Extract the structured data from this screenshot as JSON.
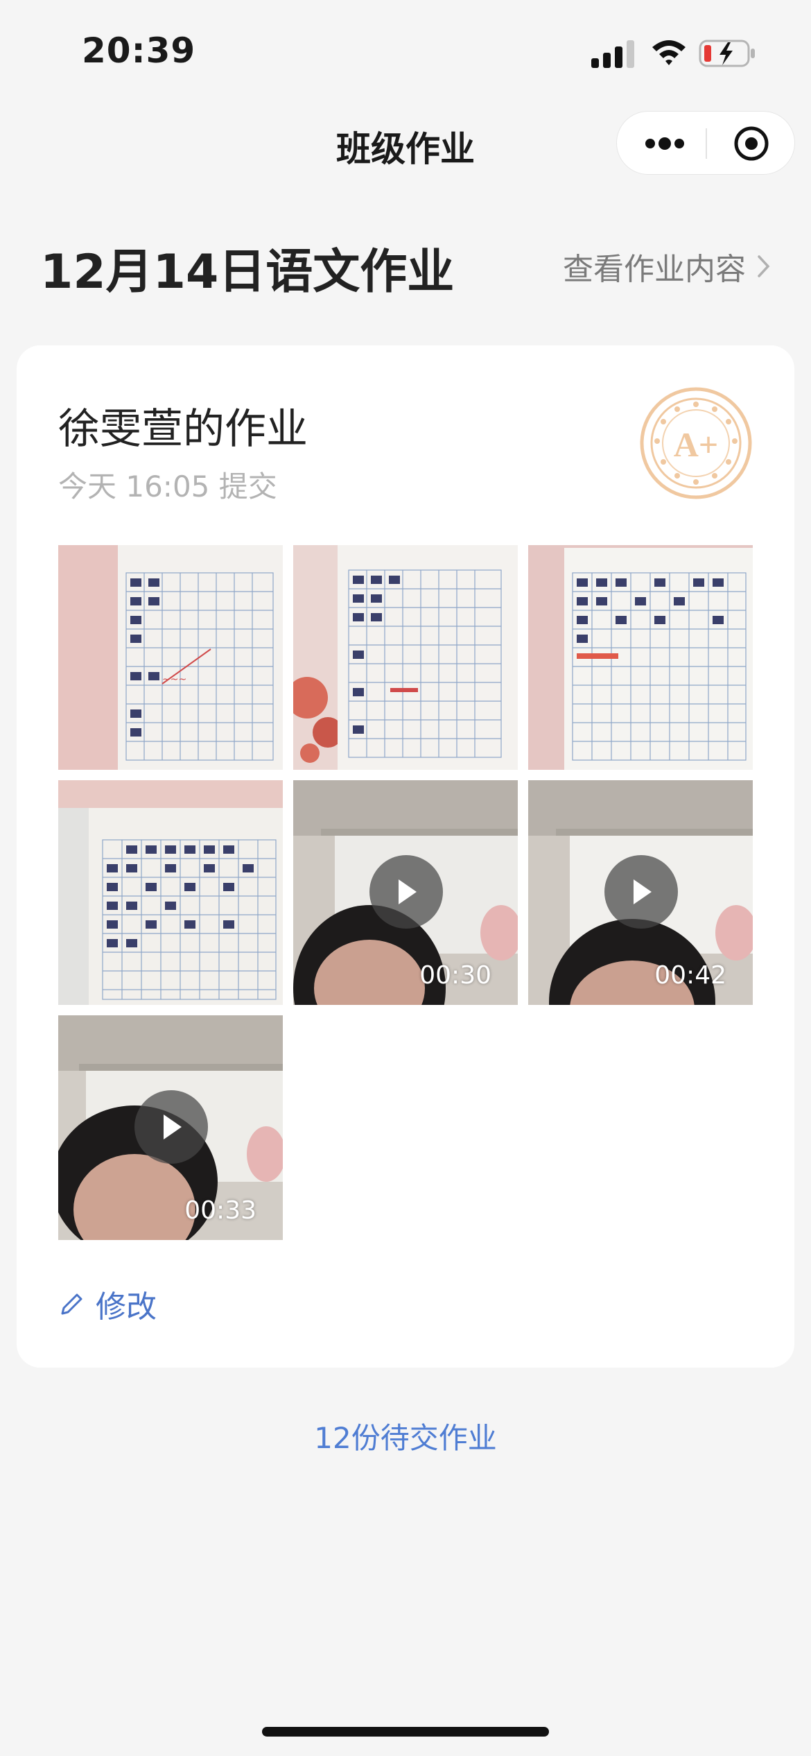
{
  "status": {
    "time": "20:39"
  },
  "nav": {
    "title": "班级作业",
    "more_icon": "more-dots-icon",
    "target_icon": "target-icon"
  },
  "header": {
    "assignment_title": "12月14日语文作业",
    "view_link": "查看作业内容"
  },
  "card": {
    "student_title": "徐雯萱的作业",
    "submit_time": "今天 16:05 提交",
    "grade": "A+",
    "media": [
      {
        "type": "image",
        "name": "worksheet-photo-1"
      },
      {
        "type": "image",
        "name": "worksheet-photo-2"
      },
      {
        "type": "image",
        "name": "worksheet-photo-3"
      },
      {
        "type": "image",
        "name": "worksheet-photo-4"
      },
      {
        "type": "video",
        "duration": "00:30"
      },
      {
        "type": "video",
        "duration": "00:42"
      },
      {
        "type": "video",
        "duration": "00:33"
      }
    ],
    "edit_label": "修改"
  },
  "footer": {
    "pending_label": "12份待交作业"
  },
  "colors": {
    "accent": "#4f7dd3",
    "stamp": "#f0c8a0",
    "background": "#f5f5f5"
  }
}
